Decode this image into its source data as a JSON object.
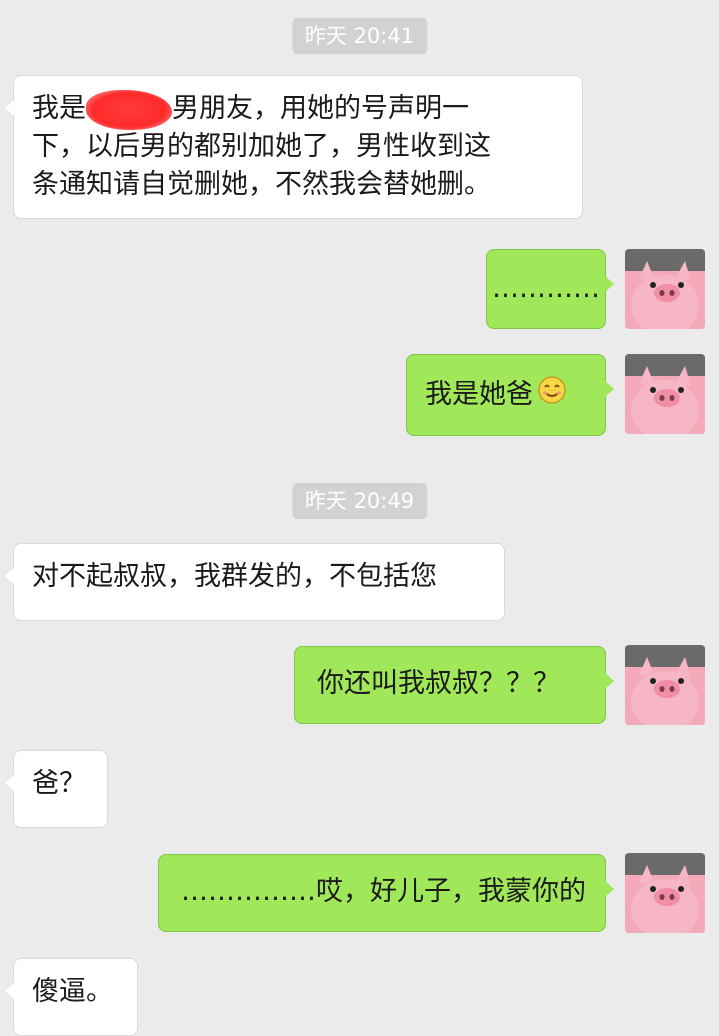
{
  "timestamps": [
    "昨天 20:41",
    "昨天 20:49"
  ],
  "messages": [
    {
      "side": "in",
      "lines": [
        "我是",
        "男朋友，用她的号声明一",
        "下，以后男的都别加她了，男性收到这",
        "条通知请自觉删她，不然我会替她删。"
      ]
    },
    {
      "side": "out",
      "text": "…………"
    },
    {
      "side": "out",
      "text": "我是她爸",
      "emoji": "smile-emoji"
    },
    {
      "side": "in",
      "text": "对不起叔叔，我群发的，不包括您"
    },
    {
      "side": "out",
      "text": "你还叫我叔叔？？？"
    },
    {
      "side": "in",
      "text": "爸？"
    },
    {
      "side": "out",
      "text": "……………哎，好儿子，我蒙你的"
    },
    {
      "side": "in",
      "text": "傻逼。"
    }
  ],
  "colors": {
    "background": "#ebebeb",
    "incoming_bubble": "#ffffff",
    "outgoing_bubble": "#a0e75a",
    "timestamp_bg": "#d2d2d2",
    "redaction": "#ff2a2a",
    "avatar_pig": "#f2a3b4"
  },
  "avatar": {
    "icon": "pink-pig-avatar-icon"
  }
}
